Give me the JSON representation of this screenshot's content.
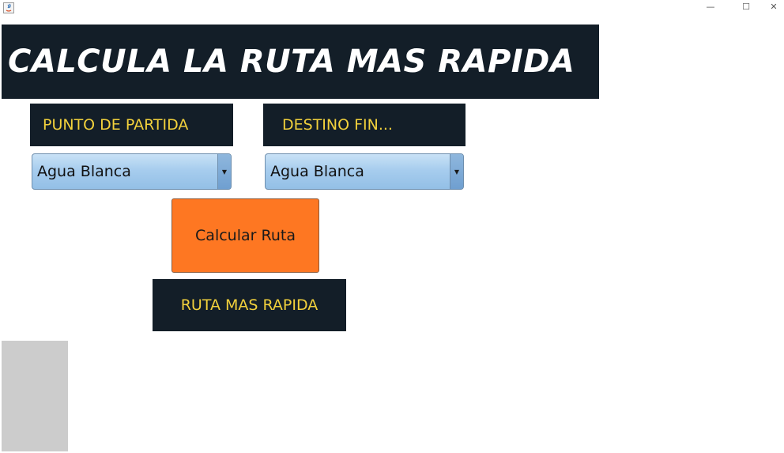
{
  "window": {
    "minimize_glyph": "—",
    "maximize_glyph": "☐",
    "close_glyph": "✕",
    "app_icon": "java-icon"
  },
  "header": {
    "title": "CALCULA LA RUTA MAS RAPIDA"
  },
  "origin": {
    "label": "PUNTO DE PARTIDA",
    "selected": "Agua Blanca",
    "arrow": "▼"
  },
  "destination": {
    "label": "DESTINO FIN...",
    "selected": "Agua Blanca",
    "arrow": "▼"
  },
  "actions": {
    "calculate_label": "Calcular Ruta"
  },
  "result": {
    "label": "RUTA MAS RAPIDA"
  },
  "colors": {
    "dark_panel": "#131e28",
    "label_text": "#f2d13c",
    "button": "#fe7722",
    "combo": "#a7cdee",
    "gray_panel": "#cccccc"
  }
}
